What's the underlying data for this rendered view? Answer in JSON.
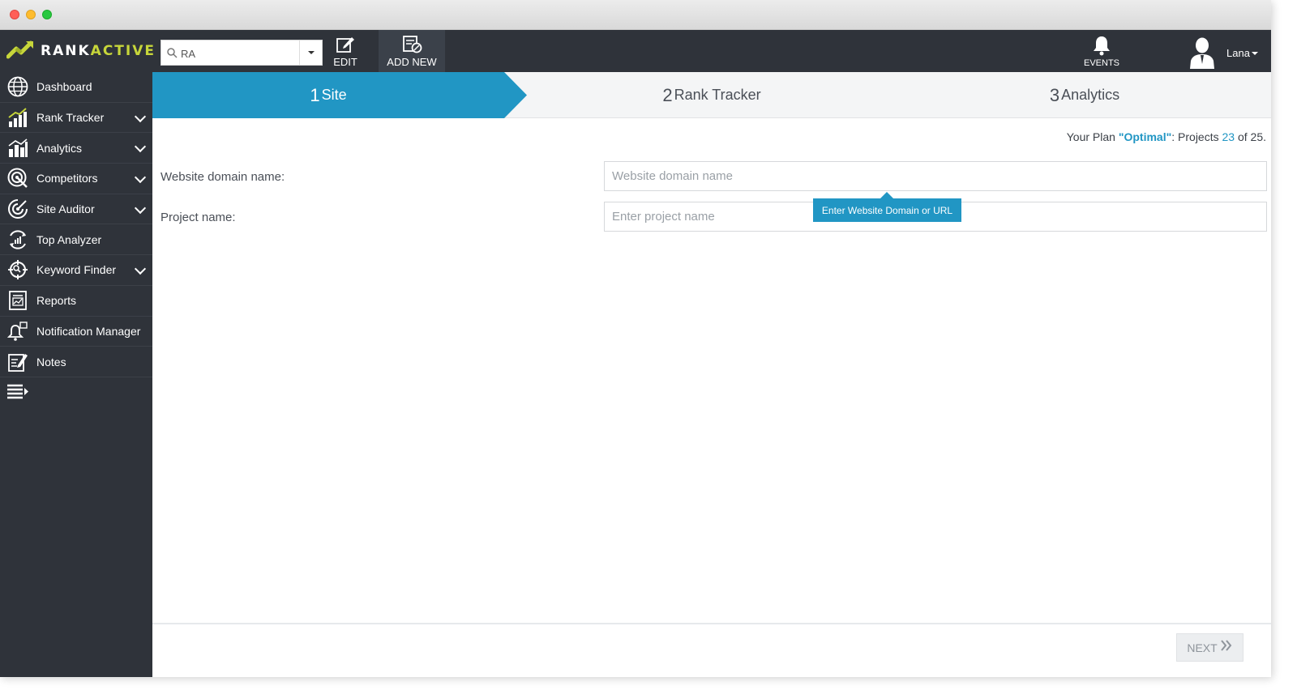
{
  "window": {
    "controls": [
      "close",
      "minimize",
      "maximize"
    ]
  },
  "topbar": {
    "logo": {
      "part1": "RANK",
      "part2": "ACTIVE"
    },
    "search": {
      "value": "RA"
    },
    "edit_label": "EDIT",
    "add_new_label": "ADD NEW",
    "events_label": "EVENTS",
    "user_name": "Lana"
  },
  "sidebar": {
    "items": [
      {
        "label": "Dashboard",
        "icon": "globe-icon",
        "expandable": false
      },
      {
        "label": "Rank Tracker",
        "icon": "rank-chart-icon",
        "expandable": true
      },
      {
        "label": "Analytics",
        "icon": "bar-chart-icon",
        "expandable": true
      },
      {
        "label": "Competitors",
        "icon": "target-icon",
        "expandable": true
      },
      {
        "label": "Site Auditor",
        "icon": "radar-icon",
        "expandable": true
      },
      {
        "label": "Top Analyzer",
        "icon": "analyzer-icon",
        "expandable": false
      },
      {
        "label": "Keyword Finder",
        "icon": "crosshair-icon",
        "expandable": true
      },
      {
        "label": "Reports",
        "icon": "report-icon",
        "expandable": false
      },
      {
        "label": "Notification Manager",
        "icon": "bell-icon",
        "expandable": false
      },
      {
        "label": "Notes",
        "icon": "notes-icon",
        "expandable": false
      }
    ]
  },
  "wizard": {
    "steps": [
      {
        "num": "1",
        "label": "Site",
        "active": true
      },
      {
        "num": "2",
        "label": "Rank Tracker",
        "active": false
      },
      {
        "num": "3",
        "label": "Analytics",
        "active": false
      }
    ]
  },
  "plan": {
    "prefix": "Your Plan ",
    "name": "\"Optimal\"",
    "middle": ": Projects ",
    "used": "23",
    "suffix": " of 25."
  },
  "form": {
    "domain_label": "Website domain name:",
    "domain_placeholder": "Website domain name",
    "domain_value": "",
    "project_label": "Project name:",
    "project_placeholder": "Enter project name",
    "project_value": "",
    "tooltip": "Enter Website Domain or URL"
  },
  "footer": {
    "next_label": "NEXT"
  },
  "colors": {
    "accent": "#2196c4",
    "sidebar_bg": "#2f333a",
    "logo_accent": "#c7d63a"
  }
}
